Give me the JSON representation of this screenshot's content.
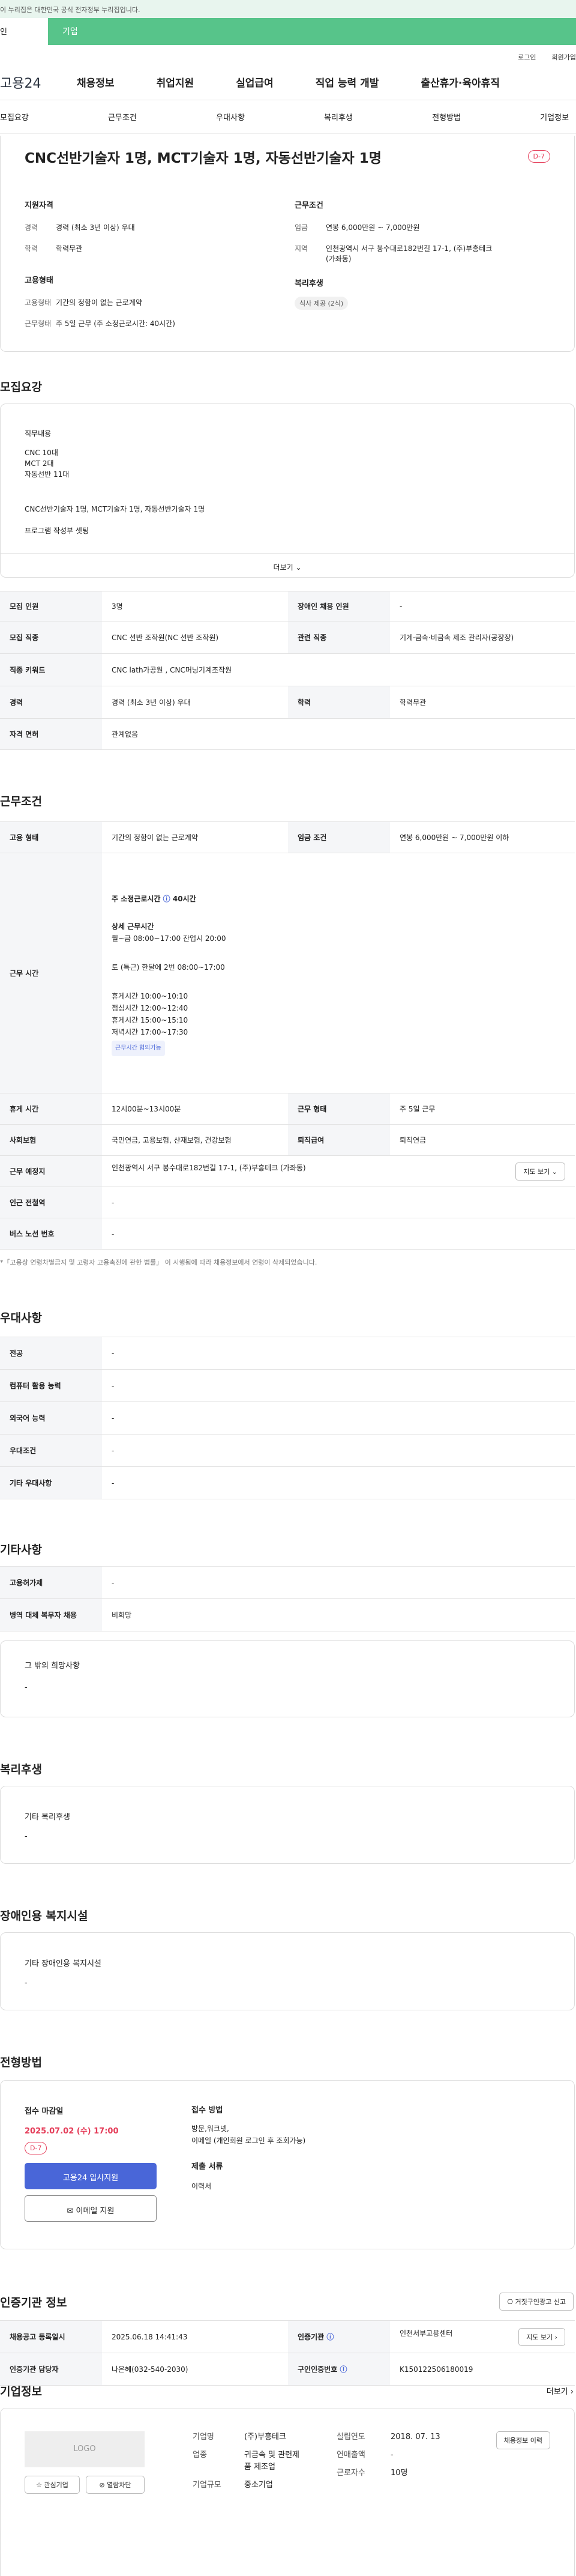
{
  "notice": "이 누리집은 대한민국 공식 전자정부 누리집입니다.",
  "green": {
    "left": "인",
    "right": "기업"
  },
  "util": {
    "login": "로그인",
    "join": "회원가입"
  },
  "gnb": {
    "logo": "고용24",
    "items": [
      "채용정보",
      "취업지원",
      "실업급여",
      "직업 능력 개발",
      "출산휴가·육아휴직"
    ]
  },
  "tabs": [
    "모집요강",
    "근무조건",
    "우대사항",
    "복리후생",
    "전형방법",
    "기업정보"
  ],
  "job": {
    "title": "CNC선반기술자 1명, MCT기술자 1명, 자동선반기술자 1명",
    "dday": "D-7",
    "quals_h": "지원자격",
    "career_k": "경력",
    "career_v": "경력 (최소 3년 이상) 우대",
    "edu_k": "학력",
    "edu_v": "학력무관",
    "emp_h": "고용형태",
    "emp_k": "고용형태",
    "emp_v": "기간의 정함이 없는 근로계약",
    "work_k": "근무형태",
    "work_v": "주 5일 근무 (주 소정근로시간: 40시간)",
    "cond_h": "근무조건",
    "wage_k": "임금",
    "wage_v": "연봉 6,000만원 ~ 7,000만원",
    "area_k": "지역",
    "area_v1": "인천광역시 서구 봉수대로182번길 17-1, (주)부흥테크",
    "area_v2": "(가좌동)",
    "welfare_h": "복리후생",
    "welfare_badge": "식사 제공 (2식)"
  },
  "recruit": {
    "title": "모집요강",
    "duty_h": "직무내용",
    "duty_lines": [
      "CNC 10대",
      "MCT  2대",
      "자동선반 11대"
    ],
    "line2": "CNC선반기술자 1명, MCT기술자 1명, 자동선반기술자 1명",
    "line3": "프로그램 작성부 셋팅",
    "more": "더보기"
  },
  "rt": {
    "r1": [
      "모집 인원",
      "3명",
      "장애인 채용 인원",
      "-"
    ],
    "r2": [
      "모집 직종",
      "CNC 선반 조작원(NC 선반 조작원)",
      "관련 직종",
      "기계·금속·비금속 제조 관리자(공장장)"
    ],
    "r3": [
      "직종 키워드",
      "CNC lath가공원 , CNC머닝기계조작원"
    ],
    "r4": [
      "경력",
      "경력 (최소 3년 이상) 우대",
      "학력",
      "학력무관"
    ],
    "r5": [
      "자격 면허",
      "관계없음"
    ]
  },
  "wc": {
    "title": "근무조건",
    "emp": [
      "고용 형태",
      "기간의 정함이 없는 근로계약",
      "임금 조건",
      "연봉 6,000만원 ~ 7,000만원 이하"
    ],
    "hours_k": "근무 시간",
    "hours_main": "주 소정근로시간",
    "hours_val": "40시간",
    "detail_h": "상세 근무시간",
    "d1": "월~금 08:00~17:00 잔업시 20:00",
    "d2": "토 (특근) 한달에 2번 08:00~17:00",
    "d3": "휴게시간 10:00~10:10",
    "d4": "점심시간 12:00~12:40",
    "d5": "휴게시간 15:00~15:10",
    "d6": "저녁시간 17:00~17:30",
    "hours_badge": "근무시간 협의가능",
    "rest": [
      "휴게 시간",
      "12시00분~13시00분",
      "근무 형태",
      "주 5일 근무"
    ],
    "ins": [
      "사회보험",
      "국민연금, 고용보험, 산재보험, 건강보험",
      "퇴직급여",
      "퇴직연금"
    ],
    "place": [
      "근무 예정지",
      "인천광역시 서구 봉수대로182번길 17-1, (주)부흥테크 (가좌동)"
    ],
    "map_btn": "지도 보기",
    "station": [
      "인근 전철역",
      "-"
    ],
    "bus": [
      "버스 노선 번호",
      "-"
    ],
    "footnote": "*「고용상 연령차별금지 및 고령자 고용촉진에 관한 법률」 이 시행됨에 따라 채용정보에서 연령이 삭제되었습니다."
  },
  "pref": {
    "title": "우대사항",
    "rows": [
      [
        "전공",
        "-"
      ],
      [
        "컴퓨터 활용 능력",
        "-"
      ],
      [
        "외국어 능력",
        "-"
      ],
      [
        "우대조건",
        "-"
      ],
      [
        "기타 우대사항",
        "-"
      ]
    ]
  },
  "etc": {
    "title": "기타사항",
    "rows": [
      [
        "고용허가제",
        "-"
      ],
      [
        "병역 대체 복무자 채용",
        "비희망"
      ]
    ],
    "other_h": "그 밖의 희망사항",
    "other_v": "-"
  },
  "welfare": {
    "title": "복리후생",
    "box_h": "기타 복리후생",
    "box_v": "-"
  },
  "disab": {
    "title": "장애인용 복지시설",
    "box_h": "기타 장애인용 복지시설",
    "box_v": "-"
  },
  "proc": {
    "title": "전형방법",
    "deadline_h": "접수 마감일",
    "deadline": "2025.07.02 (수) 17:00",
    "dday": "D-7",
    "apply": "고용24 입사지원",
    "email": "이메일 지원",
    "method_h": "접수 방법",
    "method_v1": "방문,워크넷,",
    "method_v2": "이메일 (개인회원 로그인 후 조회가능)",
    "docs_h": "제출 서류",
    "docs_v": "이력서"
  },
  "agency": {
    "title": "인증기관 정보",
    "report_btn": "거짓구인광고 신고",
    "r1": [
      "채용공고 등록일시",
      "2025.06.18 14:41:43",
      "인증기관",
      "인천서부고용센터"
    ],
    "map_btn": "지도 보기",
    "r2": [
      "인증기관 담당자",
      "나은혜(032-540-2030)",
      "구인인증번호",
      "K150122506180019"
    ]
  },
  "company": {
    "title": "기업정보",
    "more": "더보기",
    "logo": "LOGO",
    "fav": "관심기업",
    "block": "열람차단",
    "name_k": "기업명",
    "name_v": "(주)부흥테크",
    "industry_k": "업종",
    "industry_v1": "귀금속 및 관련제",
    "industry_v2": "품 제조업",
    "type_k": "기업규모",
    "type_v": "중소기업",
    "est_k": "설립연도",
    "est_v": "2018. 07. 13",
    "sales_k": "연매출액",
    "sales_v": "-",
    "emp_k": "근로자수",
    "emp_v": "10명",
    "detail_btn": "채용정보 이력"
  }
}
